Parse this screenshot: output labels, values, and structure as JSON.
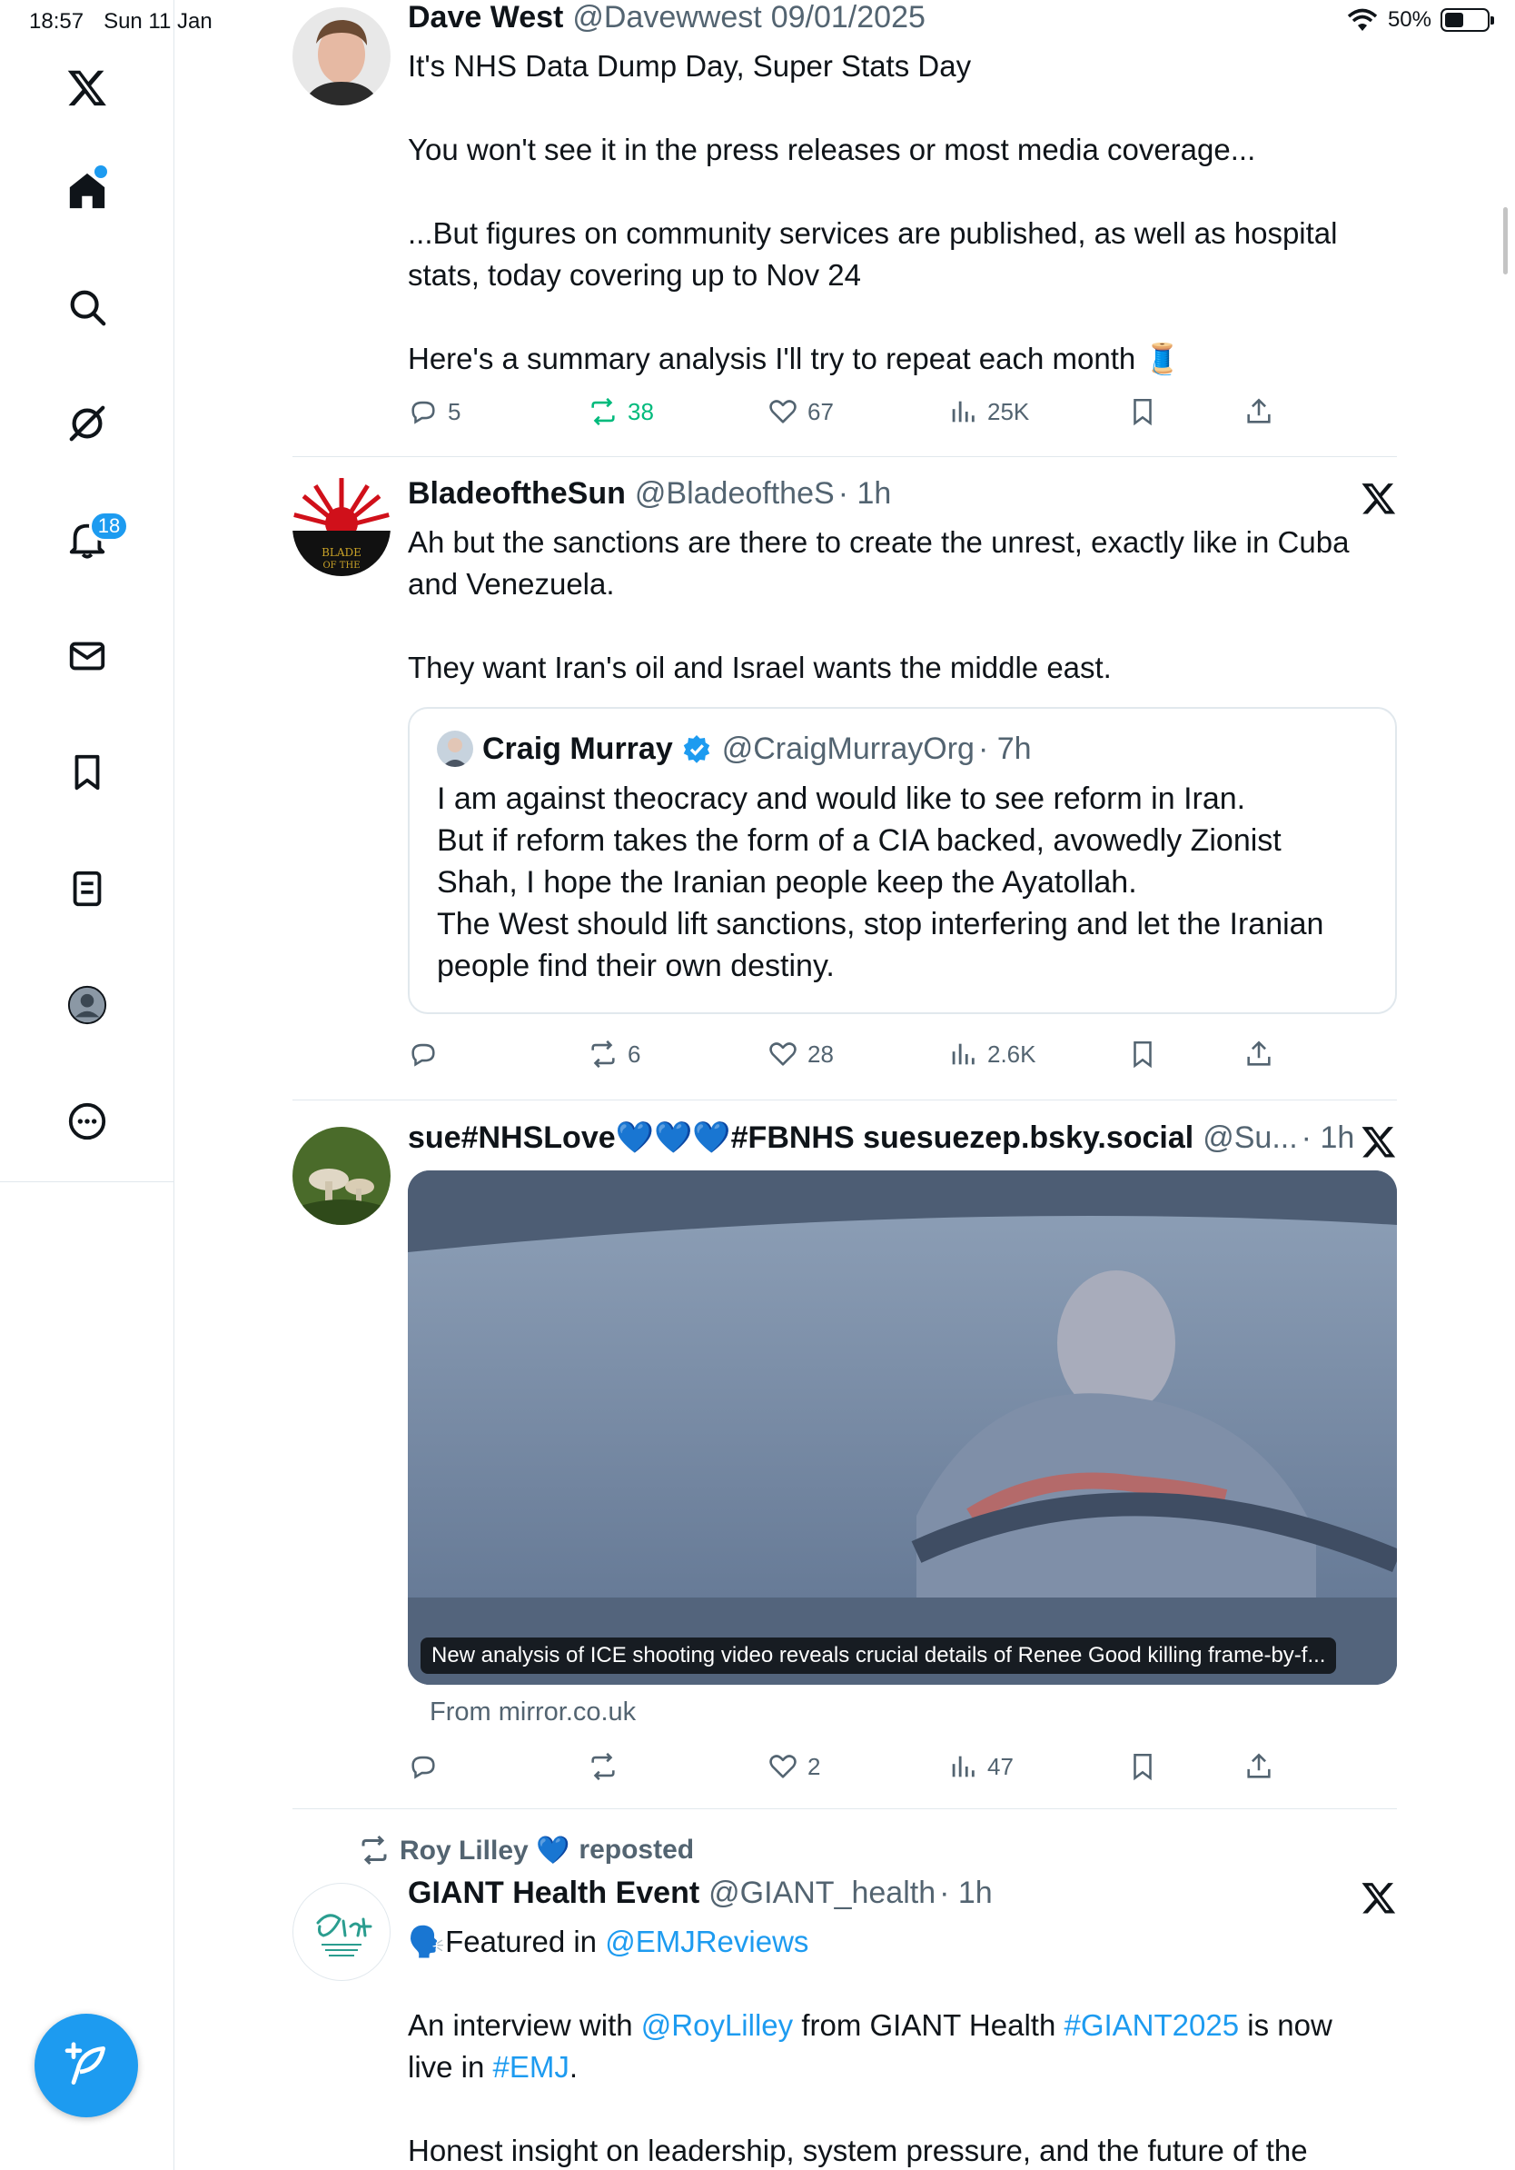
{
  "status_bar": {
    "time": "18:57",
    "date": "Sun 11 Jan",
    "battery": "50%",
    "battery_level": 0.5
  },
  "sidebar": {
    "items": [
      {
        "name": "x-logo"
      },
      {
        "name": "home",
        "dot": true
      },
      {
        "name": "search"
      },
      {
        "name": "grok"
      },
      {
        "name": "notifications",
        "badge": "18"
      },
      {
        "name": "messages"
      },
      {
        "name": "bookmarks"
      },
      {
        "name": "lists"
      },
      {
        "name": "profile"
      },
      {
        "name": "more"
      }
    ]
  },
  "posts": [
    {
      "author": "Dave West",
      "handle": "@Davewwest",
      "date": "09/01/2025",
      "text": "It's NHS Data Dump Day, Super Stats Day\n\nYou won't see it in the press releases or most media coverage...\n\n...But figures on community services are published, as well as hospital stats, today covering up to Nov 24\n\nHere's a summary analysis I'll try to repeat each month 🧵",
      "replies": "5",
      "reposts": "38",
      "likes": "67",
      "views": "25K"
    },
    {
      "author": "BladeoftheSun",
      "handle": "@BladeoftheS",
      "time": "· 1h",
      "text": "Ah but the sanctions are there to create the unrest, exactly like in Cuba and Venezuela.\n\nThey want Iran's oil and Israel wants the middle east.",
      "quote": {
        "author": "Craig Murray",
        "handle": "@CraigMurrayOrg",
        "time": "· 7h",
        "text": "I am against theocracy and would like to see reform in Iran.\nBut if reform takes the form of a CIA backed, avowedly Zionist Shah, I hope the Iranian people keep the Ayatollah.\nThe West should lift sanctions, stop interfering and let the Iranian people find their own destiny."
      },
      "replies": "",
      "reposts": "6",
      "likes": "28",
      "views": "2.6K"
    },
    {
      "author": "sue#NHSLove💙💙💙#FBNHS suesuezep.bsky.social",
      "handle": "@Su...",
      "time": "· 1h",
      "media_caption": "New analysis of ICE shooting video reveals crucial details of Renee Good killing frame-by-f...",
      "source": "From mirror.co.uk",
      "replies": "",
      "reposts": "",
      "likes": "2",
      "views": "47"
    },
    {
      "repost_by": "Roy Lilley 💙",
      "repost_label": "reposted",
      "author": "GIANT Health Event",
      "handle": "@GIANT_health",
      "time": "· 1h",
      "line1_pre": "🗣️Featured in ",
      "line1_link": "@EMJReviews",
      "line2_pre": "An interview with ",
      "line2_link1": "@RoyLilley",
      "line2_mid": " from GIANT Health ",
      "line2_link2": "#GIANT2025",
      "line2_post": " is now",
      "line3_pre": "live in ",
      "line3_link": "#EMJ",
      "line3_post": ".",
      "line4": "Honest insight on leadership, system pressure, and the future of the"
    }
  ],
  "colors": {
    "accent": "#1d9bf0",
    "text": "#0f1419",
    "muted": "#536471",
    "repost": "#00ba7c"
  }
}
